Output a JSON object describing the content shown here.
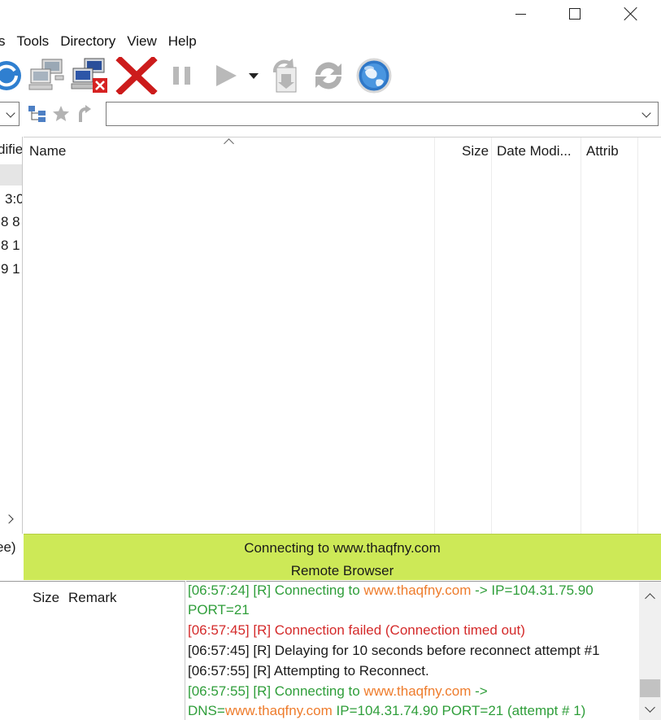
{
  "menu": {
    "items": [
      "s",
      "Tools",
      "Directory",
      "View",
      "Help"
    ]
  },
  "toolbar": {
    "buttons": [
      "refresh-icon",
      "connect-computer-icon",
      "disconnect-computer-icon",
      "abort-icon",
      "pause-icon",
      "play-icon",
      "dropdown-arrow-icon",
      "transfer-queue-icon",
      "synchronize-icon",
      "globe-icon"
    ]
  },
  "address": {
    "remote_path": ""
  },
  "left_pane": {
    "header": "difie",
    "rows": [
      "3:0",
      "8 8",
      "8 1",
      "9 1"
    ],
    "status": "ee)"
  },
  "remote_pane": {
    "columns": {
      "name": "Name",
      "size": "Size",
      "date_modified": "Date Modi...",
      "attrib": "Attrib"
    }
  },
  "status": {
    "line1": "Connecting to www.thaqfny.com",
    "line2": "Remote Browser"
  },
  "queue": {
    "columns": {
      "size": "Size",
      "remark": "Remark"
    }
  },
  "log": {
    "l1_a": "[06:57:24] [R] Connecting to ",
    "l1_b": "www.thaqfny.com",
    "l1_c": " -> IP=104.31.75.90",
    "l2": "PORT=21",
    "l3": "[06:57:45] [R] Connection failed (Connection timed out)",
    "l4": "[06:57:45] [R] Delaying for 10 seconds before reconnect attempt #1",
    "l5": "[06:57:55] [R] Attempting to Reconnect.",
    "l6_a": "[06:57:55] [R] Connecting to ",
    "l6_b": "www.thaqfny.com",
    "l6_c": " ->",
    "l7_a": "DNS=",
    "l7_b": "www.thaqfny.com",
    "l7_c": " IP=104.31.74.90 PORT=21 (attempt # 1)"
  },
  "colors": {
    "status_bg": "#cde957",
    "log_green": "#2f9e3a",
    "log_orange": "#ee7c2c",
    "log_red": "#d42a2a"
  }
}
